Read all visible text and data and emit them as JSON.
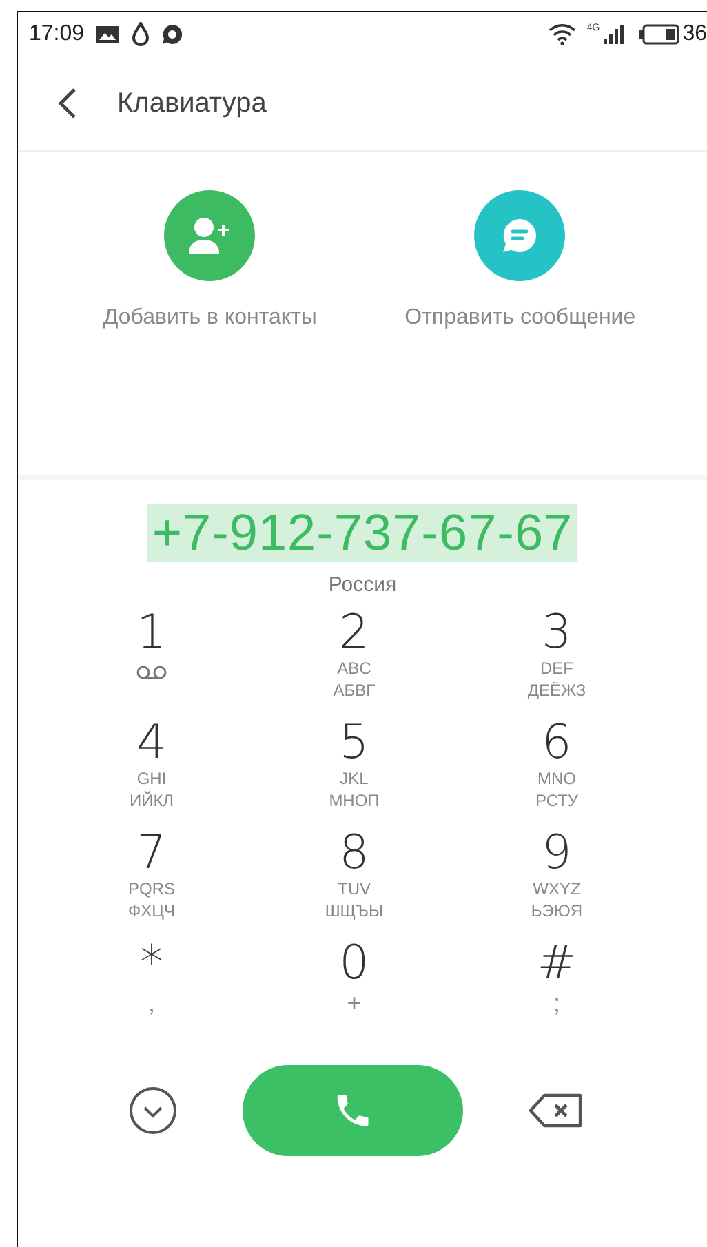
{
  "status_bar": {
    "time": "17:09",
    "network": "4G",
    "battery": "36"
  },
  "header": {
    "title": "Клавиатура"
  },
  "actions": [
    {
      "kind": "add-contact",
      "label": "Добавить в контакты",
      "color": "#3dbb62"
    },
    {
      "kind": "message",
      "label": "Отправить сообщение",
      "color": "#25c2c6"
    }
  ],
  "number": {
    "value": "+7-912-737-67-67",
    "selected": true
  },
  "region": "Россия",
  "keys": [
    {
      "digit": "1",
      "kind": "voicemail"
    },
    {
      "digit": "2",
      "kind": "letters",
      "letters": [
        "ABC",
        "АБВГ"
      ]
    },
    {
      "digit": "3",
      "kind": "letters",
      "letters": [
        "DEF",
        "ДЕЁЖЗ"
      ]
    },
    {
      "digit": "4",
      "kind": "letters",
      "letters": [
        "GHI",
        "ИЙКЛ"
      ]
    },
    {
      "digit": "5",
      "kind": "letters",
      "letters": [
        "JKL",
        "МНОП"
      ]
    },
    {
      "digit": "6",
      "kind": "letters",
      "letters": [
        "MNO",
        "РСТУ"
      ]
    },
    {
      "digit": "7",
      "kind": "letters",
      "letters": [
        "PQRS",
        "ФХЦЧ"
      ]
    },
    {
      "digit": "8",
      "kind": "letters",
      "letters": [
        "TUV",
        "ШЩЪЫ"
      ]
    },
    {
      "digit": "9",
      "kind": "letters",
      "letters": [
        "WXYZ",
        "ЬЭЮЯ"
      ]
    },
    {
      "digit": "*",
      "kind": "symbol",
      "symbol": ","
    },
    {
      "digit": "0",
      "kind": "symbol",
      "symbol": "+"
    },
    {
      "digit": "#",
      "kind": "symbol",
      "symbol": ";"
    }
  ]
}
